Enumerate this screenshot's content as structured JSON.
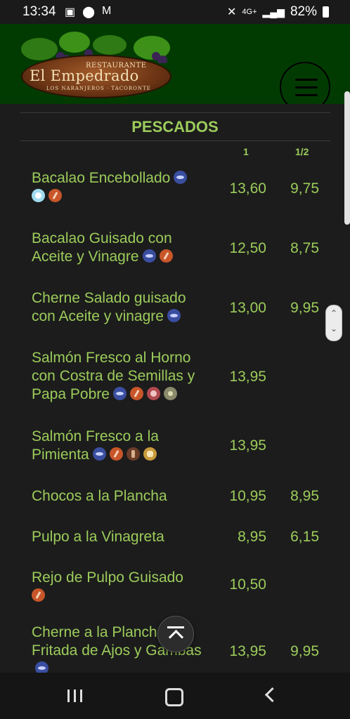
{
  "status": {
    "time": "13:34",
    "network": "4G+",
    "battery": "82%"
  },
  "header": {
    "logo_small": "RESTAURANTE",
    "logo_name": "El Empedrado",
    "logo_sub": "LOS NARANJEROS · TACORONTE"
  },
  "menu": {
    "section": "PESCADOS",
    "col_full": "1",
    "col_half": "1/2",
    "items": [
      {
        "name": "Bacalao Encebollado",
        "p1": "13,60",
        "p2": "9,75"
      },
      {
        "name": "Bacalao Guisado con Aceite y Vinagre",
        "p1": "12,50",
        "p2": "8,75"
      },
      {
        "name": "Cherne Salado guisado con Aceite y vinagre",
        "p1": "13,00",
        "p2": "9,95"
      },
      {
        "name": "Salmón Fresco al Horno con Costra de Semillas y Papa Pobre",
        "p1": "13,95",
        "p2": ""
      },
      {
        "name": "Salmón Fresco a la Pimienta",
        "p1": "13,95",
        "p2": ""
      },
      {
        "name": "Chocos a la Plancha",
        "p1": "10,95",
        "p2": "8,95"
      },
      {
        "name": "Pulpo a la Vinagreta",
        "p1": "8,95",
        "p2": "6,15"
      },
      {
        "name": "Rejo de Pulpo Guisado",
        "p1": "10,50",
        "p2": ""
      },
      {
        "name": "Cherne a la Plancha con Fritada de Ajos y Gambas",
        "p1": "13,95",
        "p2": "9,95"
      }
    ]
  },
  "colors": {
    "accent": "#9ccc5b",
    "header_bg": "#023b02",
    "page_bg": "#1c1c1c"
  }
}
